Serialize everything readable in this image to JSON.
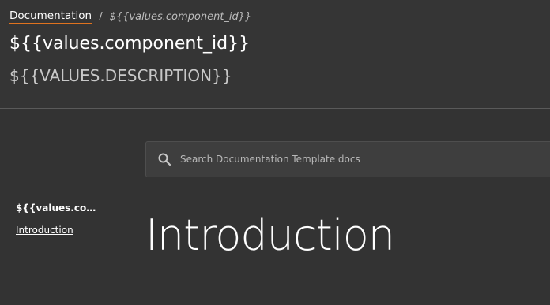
{
  "breadcrumb": {
    "root_label": "Documentation",
    "separator": "/",
    "current": "${{values.component_id}}"
  },
  "header": {
    "title": "${{values.component_id}}",
    "subtitle": "${{VALUES.DESCRIPTION}}"
  },
  "search": {
    "icon": "search-icon",
    "placeholder": "Search Documentation Template docs",
    "value": ""
  },
  "sidebar": {
    "heading": "${{values.component_id}}",
    "items": [
      {
        "label": "Introduction"
      }
    ]
  },
  "content": {
    "heading": "Introduction"
  },
  "colors": {
    "background": "#333333",
    "accent_underline": "#e0731f",
    "text": "#ffffff",
    "muted_text": "#bdbdbd"
  }
}
